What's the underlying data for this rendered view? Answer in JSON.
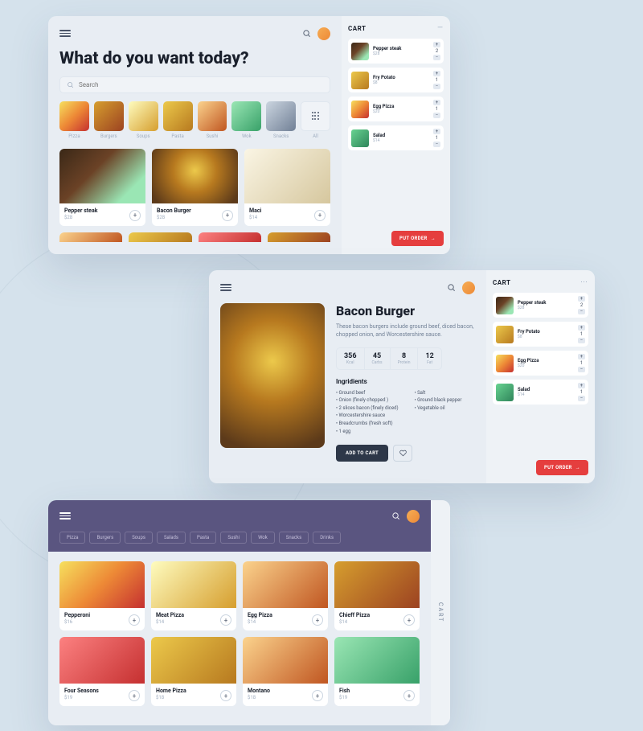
{
  "screen1": {
    "title": "What do you want today?",
    "search_placeholder": "Search",
    "categories": [
      {
        "label": "Pizza"
      },
      {
        "label": "Burgers"
      },
      {
        "label": "Soups"
      },
      {
        "label": "Pasta"
      },
      {
        "label": "Sushi"
      },
      {
        "label": "Wok"
      },
      {
        "label": "Snacks"
      }
    ],
    "cat_all": "All",
    "products": [
      {
        "name": "Pepper steak",
        "price": "$28"
      },
      {
        "name": "Bacon Burger",
        "price": "$28"
      },
      {
        "name": "Maci",
        "price": "$14"
      }
    ]
  },
  "cart": {
    "title": "CART",
    "items": [
      {
        "name": "Pepper steak",
        "price": "$28",
        "qty": "2"
      },
      {
        "name": "Fry Potato",
        "price": "$8",
        "qty": "1"
      },
      {
        "name": "Egg Pizza",
        "price": "$20",
        "qty": "1"
      },
      {
        "name": "Salad",
        "price": "$14",
        "qty": "1"
      }
    ],
    "order_btn": "PUT ORDER"
  },
  "cart2": {
    "items": [
      {
        "name": "Pepper steak",
        "price": "$28",
        "qty": "2"
      },
      {
        "name": "Fry Potato",
        "price": "$8",
        "qty": "1"
      },
      {
        "name": "Egg Pizza",
        "price": "$20",
        "qty": "1"
      },
      {
        "name": "Salad",
        "price": "$14",
        "qty": "1"
      }
    ]
  },
  "detail": {
    "title": "Bacon Burger",
    "desc": "These bacon burgers include ground beef, diced bacon, chopped onion, and Worcestershire sauce.",
    "nutrition": [
      {
        "val": "356",
        "lab": "Kcal"
      },
      {
        "val": "45",
        "lab": "Carbs"
      },
      {
        "val": "8",
        "lab": "Protein"
      },
      {
        "val": "12",
        "lab": "Fat"
      }
    ],
    "ing_title": "Ingridients",
    "ingredients_col1": [
      "Ground beef",
      "Onion (finely chopped )",
      "2 slices bacon (finely diced)",
      "Worcestershire sauce",
      "Breadcrumbs (fresh soft)",
      "1 egg"
    ],
    "ingredients_col2": [
      "Salt",
      "Ground black pepper",
      "Vegetable oil"
    ],
    "add_btn": "ADD TO CART"
  },
  "screen3": {
    "pills": [
      "Pizza",
      "Burgers",
      "Soups",
      "Salads",
      "Pasta",
      "Sushi",
      "Wok",
      "Snacks",
      "Drinks"
    ],
    "products": [
      {
        "name": "Pepperoni",
        "price": "$16"
      },
      {
        "name": "Meat Pizza",
        "price": "$14"
      },
      {
        "name": "Egg Pizza",
        "price": "$14"
      },
      {
        "name": "Chieff Pizza",
        "price": "$14"
      },
      {
        "name": "Four Seasons",
        "price": "$19"
      },
      {
        "name": "Home Pizza",
        "price": "$18"
      },
      {
        "name": "Montano",
        "price": "$18"
      },
      {
        "name": "Fish",
        "price": "$19"
      }
    ],
    "cart_label": "CART"
  }
}
